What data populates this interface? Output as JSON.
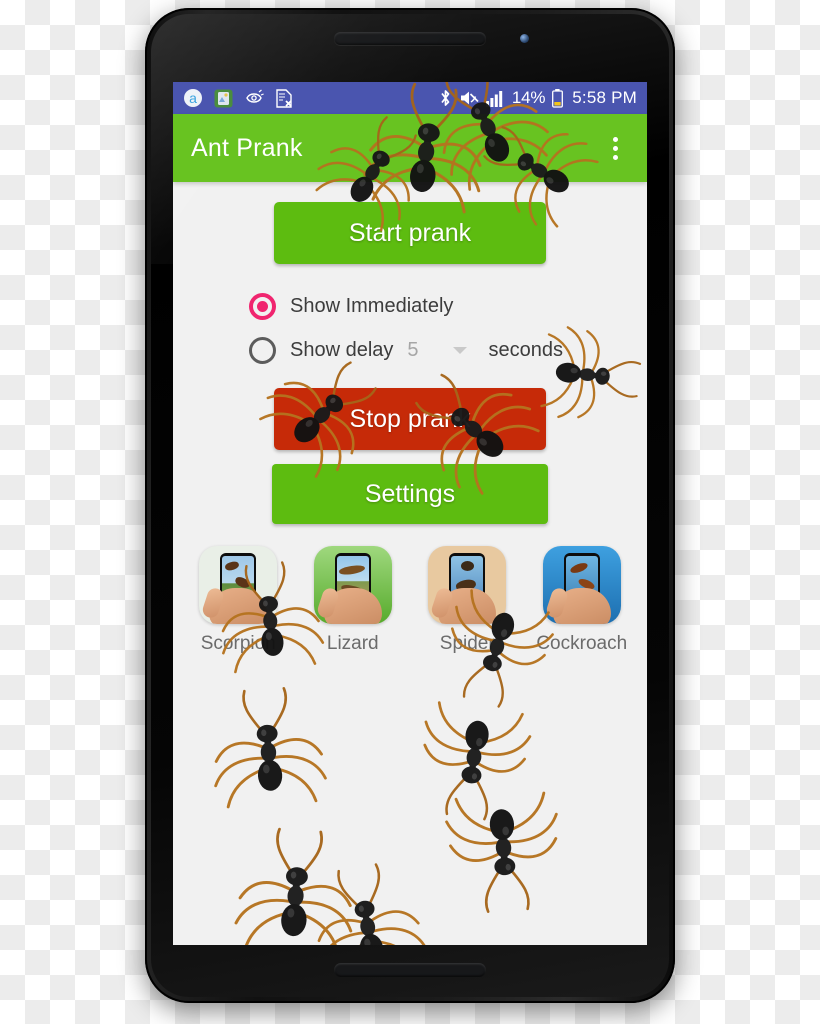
{
  "status_bar": {
    "left_icons": [
      {
        "name": "amazon-app-icon",
        "glyph": "a"
      },
      {
        "name": "gallery-app-icon",
        "glyph": "ὛC"
      },
      {
        "name": "phone-ring-icon",
        "glyph": "☎"
      },
      {
        "name": "document-error-icon",
        "glyph": "὜E"
      }
    ],
    "bluetooth_icon": "bluetooth-icon",
    "volume_muted_icon": "volume-muted-icon",
    "signal_icon": "signal-bars-icon",
    "battery_percent": "14%",
    "battery_icon": "battery-low-icon",
    "time": "5:58 PM",
    "background_color": "#4a55af"
  },
  "app_bar": {
    "title": "Ant Prank",
    "overflow_menu": "overflow-menu",
    "background_color": "#68c321"
  },
  "main": {
    "start_prank_label": "Start prank",
    "stop_prank_label": "Stop prank",
    "settings_label": "Settings",
    "start_color": "#5dbc10",
    "stop_color": "#c62a08",
    "settings_color": "#5dbc10",
    "radio": {
      "accent_color": "#f0256f",
      "immediate_label": "Show Immediately",
      "immediate_selected": true,
      "delay_label": "Show delay",
      "delay_selected": false,
      "delay_value": "5",
      "delay_unit": "seconds"
    },
    "promo_apps": [
      {
        "label": "Scorpion",
        "bg": "#e8efe6"
      },
      {
        "label": "Lizard",
        "bg": "#6dbf3e"
      },
      {
        "label": "Spider",
        "bg": "#e8c9a0"
      },
      {
        "label": "Cockroach",
        "bg": "#2d8fd4"
      }
    ]
  }
}
